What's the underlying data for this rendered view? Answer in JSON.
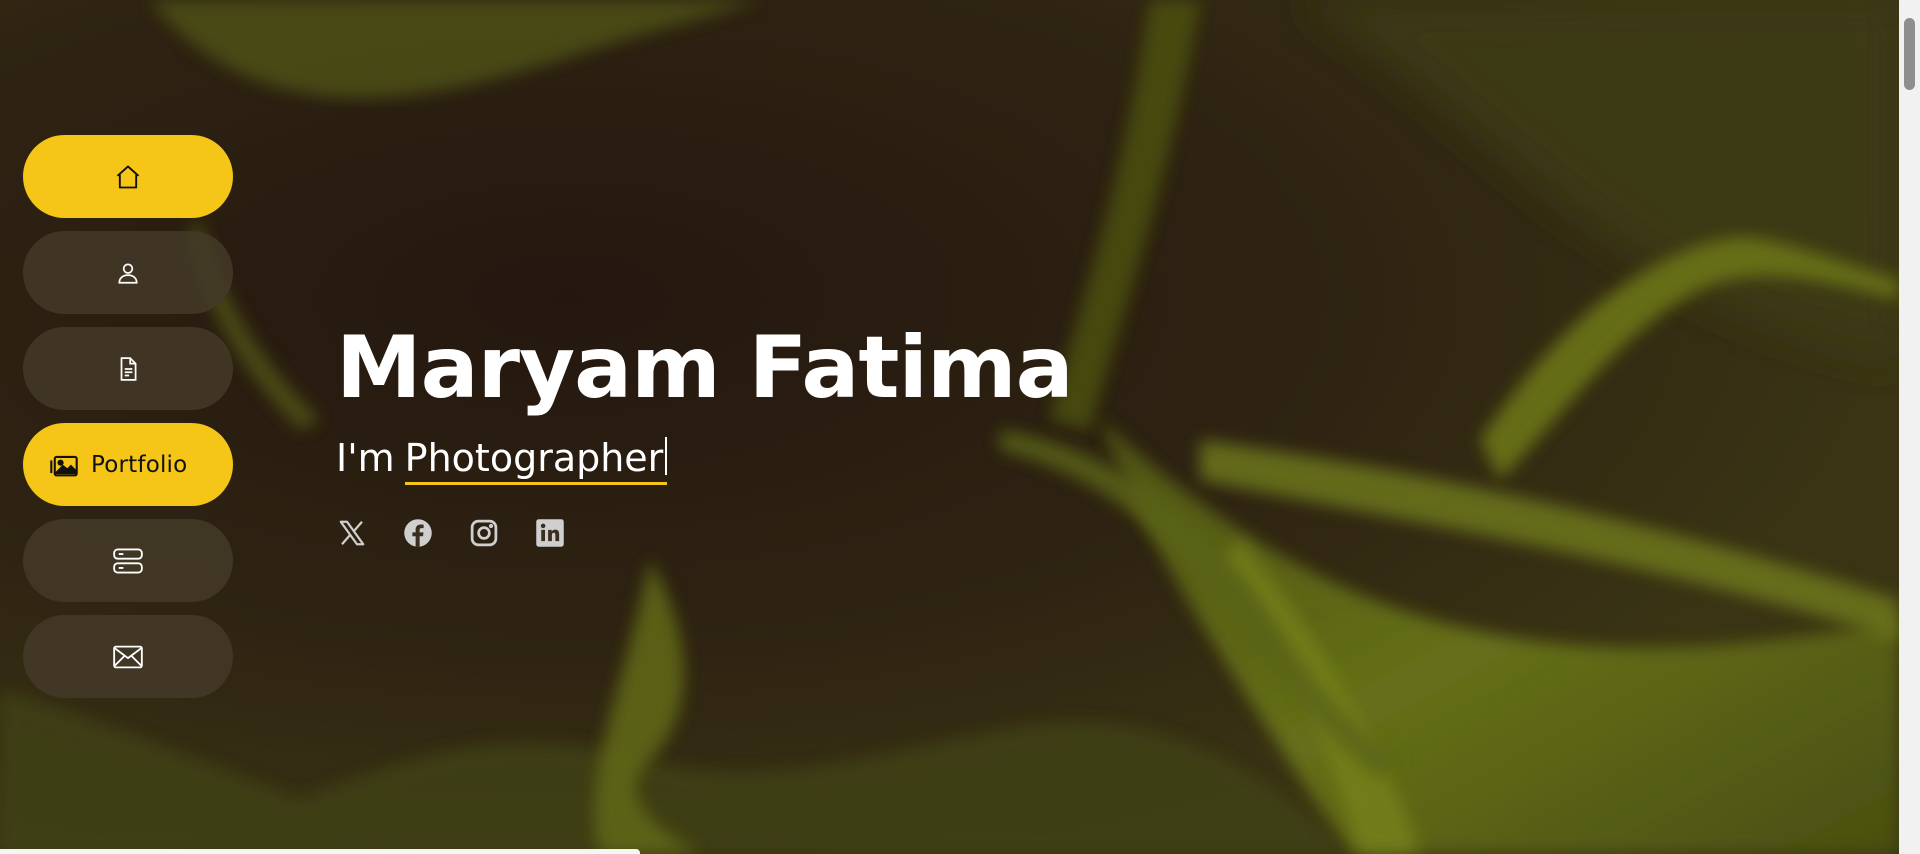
{
  "colors": {
    "accent": "#f5c518",
    "nav_bg": "#443a28",
    "text": "#ffffff",
    "bg_dark": "#2a1d12",
    "bg_olive": "#5e6614"
  },
  "nav": {
    "items": [
      {
        "icon": "home-icon",
        "label": ""
      },
      {
        "icon": "person-icon",
        "label": ""
      },
      {
        "icon": "file-text-icon",
        "label": ""
      },
      {
        "icon": "images-icon",
        "label": "Portfolio"
      },
      {
        "icon": "server-icon",
        "label": ""
      },
      {
        "icon": "envelope-icon",
        "label": ""
      }
    ]
  },
  "hero": {
    "name": "Maryam Fatima",
    "prefix": "I'm",
    "typed": "Photographer"
  },
  "socials": [
    {
      "icon": "x-twitter-icon"
    },
    {
      "icon": "facebook-icon"
    },
    {
      "icon": "instagram-icon"
    },
    {
      "icon": "linkedin-icon"
    }
  ]
}
